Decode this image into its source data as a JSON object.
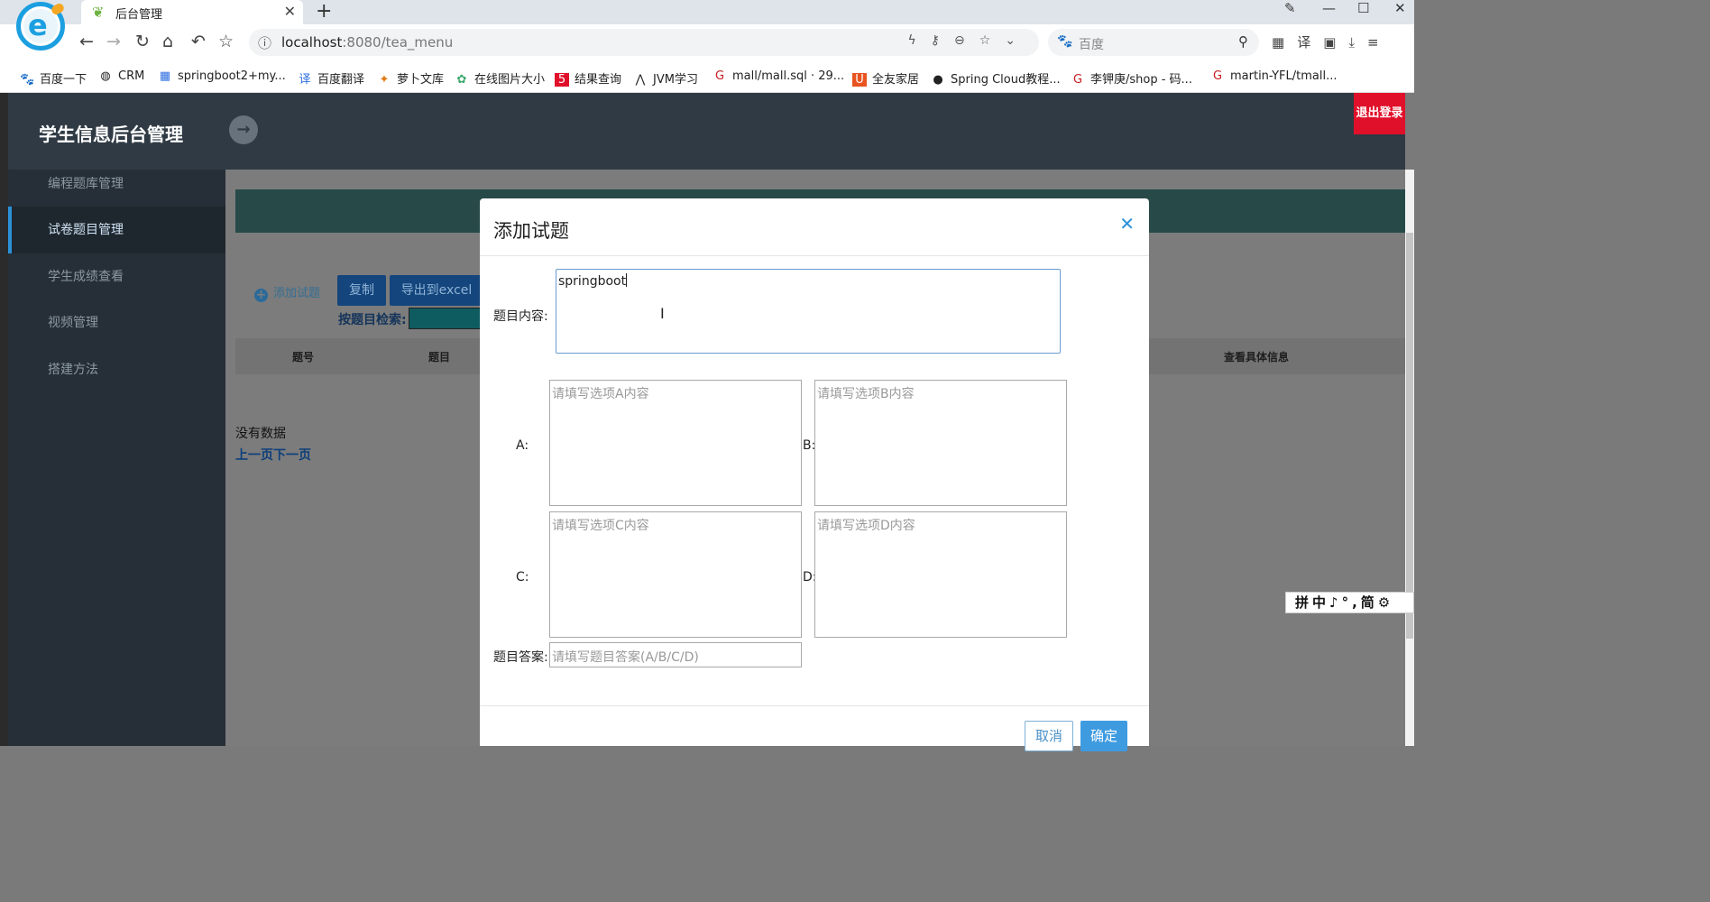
{
  "browser": {
    "tab_title": "后台管理",
    "url_host": "localhost",
    "url_rest": ":8080/tea_menu",
    "search_placeholder": "百度",
    "bookmarks": [
      {
        "icon": "baidu-paw-icon",
        "glyph": "🐾",
        "label": "百度一下"
      },
      {
        "icon": "globe-icon",
        "glyph": "◍",
        "label": "CRM"
      },
      {
        "icon": "bookmark-grid-icon",
        "glyph": "▦",
        "label": "springboot2+my..."
      },
      {
        "icon": "translate-icon",
        "glyph": "译",
        "label": "百度翻译"
      },
      {
        "icon": "carrot-icon",
        "glyph": "🥕",
        "label": "萝卜文库"
      },
      {
        "icon": "flower-icon",
        "glyph": "✿",
        "label": "在线图片大小"
      },
      {
        "icon": "five-icon",
        "glyph": "5",
        "label": "结果查询"
      },
      {
        "icon": "jvm-icon",
        "glyph": "⋀",
        "label": "JVM学习"
      },
      {
        "icon": "gitee-icon",
        "glyph": "G",
        "label": "mall/mall.sql · 29..."
      },
      {
        "icon": "u-icon",
        "glyph": "U",
        "label": "全友家居"
      },
      {
        "icon": "github-icon",
        "glyph": "●",
        "label": "Spring Cloud教程..."
      },
      {
        "icon": "gitee-icon",
        "glyph": "G",
        "label": "李钾庚/shop - 码..."
      },
      {
        "icon": "gitee-icon",
        "glyph": "G",
        "label": "martin-YFL/tmall..."
      }
    ]
  },
  "app": {
    "title": "学生信息后台管理",
    "logout": "退出登录",
    "sidebar": [
      {
        "label": "编程题库管理",
        "active": false
      },
      {
        "label": "试卷题目管理",
        "active": true
      },
      {
        "label": "学生成绩查看",
        "active": false
      },
      {
        "label": "视频管理",
        "active": false
      },
      {
        "label": "搭建方法",
        "active": false
      }
    ],
    "add_question": "添加试题",
    "copy_button": "复制",
    "export_button": "导出到excel",
    "search_label": "按题目检索:",
    "table_headers": [
      "题号",
      "题目",
      "查看具体信息"
    ],
    "no_data": "没有数据",
    "pager": "上一页下一页"
  },
  "modal": {
    "title": "添加试题",
    "content_label": "题目内容:",
    "content_value": "springboot",
    "option_a_label": "A:",
    "option_b_label": "B:",
    "option_c_label": "C:",
    "option_d_label": "D:",
    "option_a_placeholder": "请填写选项A内容",
    "option_b_placeholder": "请填写选项B内容",
    "option_c_placeholder": "请填写选项C内容",
    "option_d_placeholder": "请填写选项D内容",
    "answer_label": "题目答案:",
    "answer_placeholder": "请填写题目答案(A/B/C/D)",
    "cancel": "取消",
    "confirm": "确定"
  },
  "ime": "拼中♪°,简⚙",
  "colors": {
    "accent": "#2b91d8",
    "logout": "#e0102a",
    "header": "#2f3a44",
    "sidebar": "#262f37"
  }
}
